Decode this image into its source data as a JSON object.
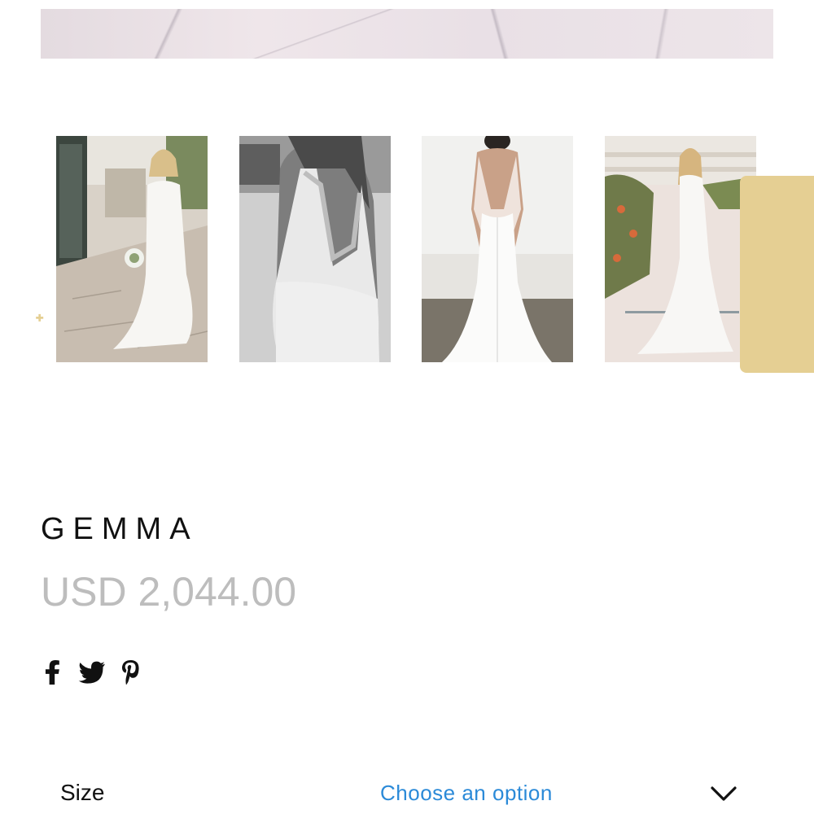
{
  "product": {
    "title": "GEMMA",
    "price": "USD 2,044.00"
  },
  "gallery": {
    "thumbnails": [
      {
        "icon": "bride-front-photo",
        "style": "color"
      },
      {
        "icon": "bride-back-detail-photo",
        "style": "black-and-white"
      },
      {
        "icon": "dress-back-studio-photo",
        "style": "color"
      },
      {
        "icon": "bride-garden-photo",
        "style": "color"
      }
    ]
  },
  "side_toolbar": {
    "color": "#e5cf93",
    "buttons": [
      {
        "icon": "user-icon"
      },
      {
        "icon": "search-icon"
      },
      {
        "icon": "add-to-cart-icon"
      }
    ]
  },
  "social": [
    {
      "icon": "facebook-icon"
    },
    {
      "icon": "twitter-icon"
    },
    {
      "icon": "pinterest-icon"
    }
  ],
  "variation": {
    "label": "Size",
    "selected": "Choose an option"
  },
  "colors": {
    "price": "#bdbdbd",
    "select_text": "#2b8ad8",
    "toolbar": "#e5cf93"
  }
}
